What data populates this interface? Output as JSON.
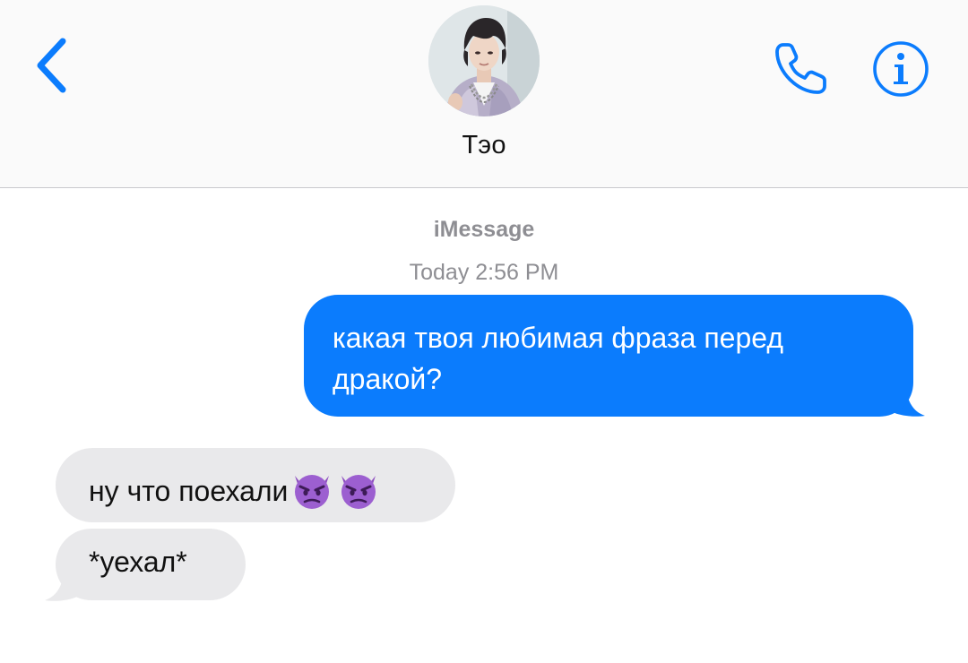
{
  "header": {
    "contact_name": "Тэо",
    "back_icon": "chevron-left-icon",
    "call_icon": "phone-icon",
    "info_icon": "info-icon"
  },
  "conversation": {
    "service": "iMessage",
    "timestamp": "Today 2:56 PM",
    "messages": [
      {
        "direction": "outgoing",
        "text": "какая твоя любимая фраза перед дракой?"
      },
      {
        "direction": "incoming",
        "text": "ну что поехали",
        "emoji": "😈😈",
        "emoji_icon": "smiling-devil-emoji"
      },
      {
        "direction": "incoming",
        "text": "*уехал*"
      }
    ]
  },
  "colors": {
    "accent": "#0b7cfd",
    "incoming_bubble": "#e9e9eb",
    "secondary_text": "#8e8e93",
    "header_background": "#fafafa"
  }
}
